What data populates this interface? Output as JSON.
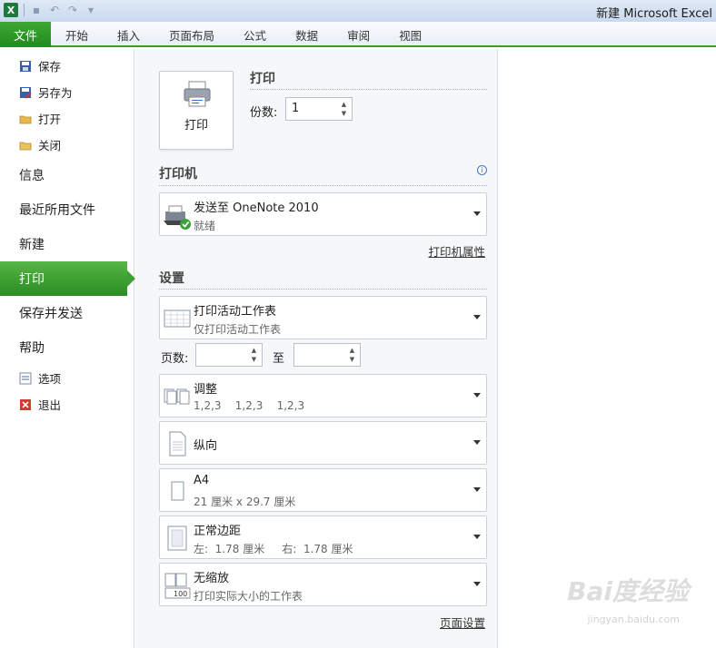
{
  "window": {
    "title": "新建 Microsoft Excel"
  },
  "ribbon": {
    "file_tab": "文件",
    "tabs": [
      "开始",
      "插入",
      "页面布局",
      "公式",
      "数据",
      "审阅",
      "视图"
    ]
  },
  "nav": {
    "small_items": [
      {
        "label": "保存",
        "icon": "save-icon"
      },
      {
        "label": "另存为",
        "icon": "save-as-icon"
      },
      {
        "label": "打开",
        "icon": "open-folder-icon"
      },
      {
        "label": "关闭",
        "icon": "close-folder-icon"
      }
    ],
    "big_items": [
      "信息",
      "最近所用文件",
      "新建",
      "打印",
      "保存并发送",
      "帮助"
    ],
    "active": "打印",
    "bottom_items": [
      {
        "label": "选项",
        "icon": "options-icon"
      },
      {
        "label": "退出",
        "icon": "exit-icon"
      }
    ]
  },
  "print": {
    "button_label": "打印",
    "section_title": "打印",
    "copies_label": "份数:",
    "copies_value": "1"
  },
  "printer": {
    "section_title": "打印机",
    "name": "发送至 OneNote 2010",
    "status": "就绪",
    "properties_link": "打印机属性"
  },
  "settings": {
    "section_title": "设置",
    "what": {
      "title": "打印活动工作表",
      "sub": "仅打印活动工作表"
    },
    "pages_label": "页数:",
    "pages_to": "至",
    "collate": {
      "title": "调整",
      "sub": "1,2,3    1,2,3    1,2,3"
    },
    "orientation": {
      "title": "纵向"
    },
    "paper": {
      "title": "A4",
      "sub": "21 厘米 x 29.7 厘米"
    },
    "margins": {
      "title": "正常边距",
      "sub": "左:  1.78 厘米     右:  1.78 厘米"
    },
    "scaling": {
      "title": "无缩放",
      "sub": "打印实际大小的工作表"
    },
    "page_setup_link": "页面设置"
  },
  "watermark": {
    "text": "Bai度经验",
    "sub": "jingyan.baidu.com"
  },
  "colors": {
    "accent_green": "#2a8d22",
    "title_bar": "#c9d9ee"
  }
}
